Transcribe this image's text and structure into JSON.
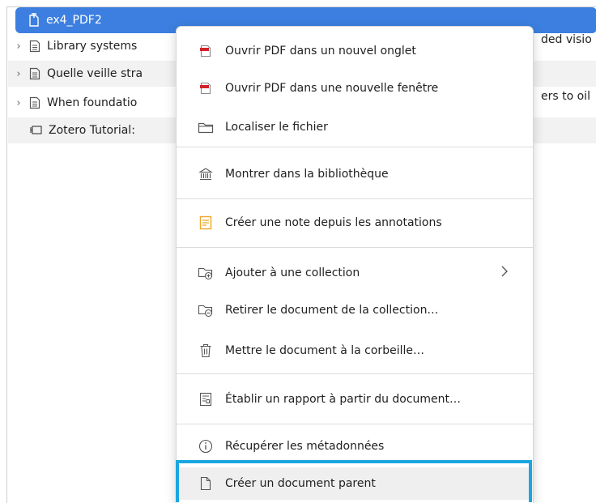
{
  "list": {
    "selected": {
      "label": "ex4_PDF2"
    },
    "rows": [
      {
        "left": "Library systems",
        "right": "ded visio"
      },
      {
        "left": "Quelle veille stra",
        "right": ""
      },
      {
        "left": "When foundatio",
        "right": "ers to oil"
      },
      {
        "left": "Zotero Tutorial:",
        "right": ""
      }
    ]
  },
  "menu": {
    "items": [
      {
        "label": "Ouvrir PDF dans un nouvel onglet",
        "icon": "pdf-icon"
      },
      {
        "label": "Ouvrir PDF dans une nouvelle fenêtre",
        "icon": "pdf-icon"
      },
      {
        "label": "Localiser le fichier",
        "icon": "folder-icon"
      },
      {
        "label": "Montrer dans la bibliothèque",
        "icon": "library-icon"
      },
      {
        "label": "Créer une note depuis les annotations",
        "icon": "note-icon"
      },
      {
        "label": "Ajouter à une collection",
        "icon": "collection-add-icon"
      },
      {
        "label": "Retirer le document de la collection…",
        "icon": "collection-remove-icon"
      },
      {
        "label": "Mettre le document à la corbeille…",
        "icon": "trash-icon"
      },
      {
        "label": "Établir un rapport à partir du document…",
        "icon": "report-icon"
      },
      {
        "label": "Récupérer les métadonnées",
        "icon": "info-icon"
      },
      {
        "label": "Créer un document parent",
        "icon": "document-icon"
      }
    ]
  },
  "colors": {
    "selection": "#3c7fe0",
    "focus": "#1aa6e0",
    "pdf": "#d2232a",
    "note": "#f0a626"
  }
}
